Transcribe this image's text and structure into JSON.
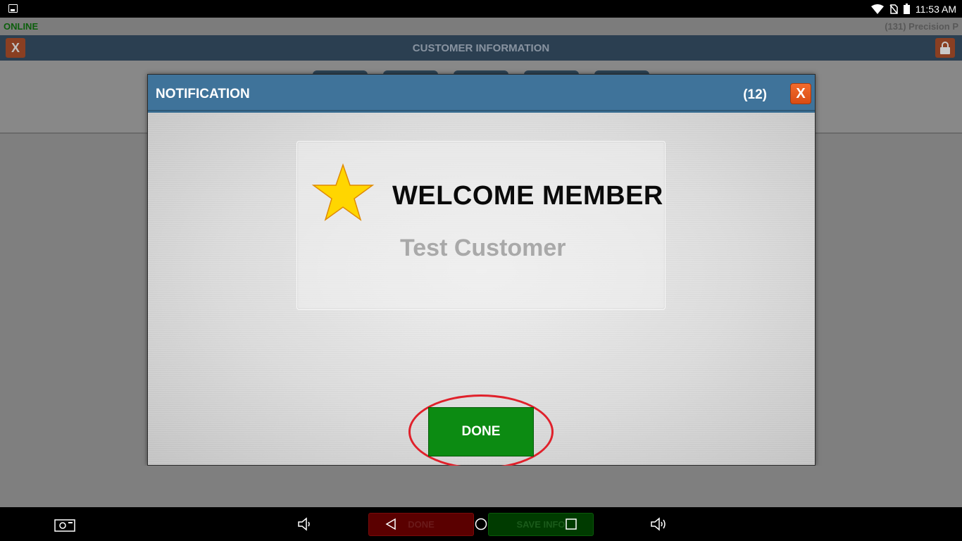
{
  "status_bar": {
    "time": "11:53 AM",
    "icons": [
      "image-icon",
      "wifi-icon",
      "no-sim-icon",
      "battery-icon"
    ]
  },
  "info_bar": {
    "status": "ONLINE",
    "store": "(131) Precision P"
  },
  "header": {
    "title": "CUSTOMER INFORMATION",
    "close_label": "X",
    "lock_icon": "lock-icon"
  },
  "dialog": {
    "title": "NOTIFICATION",
    "count": "(12)",
    "close_label": "X",
    "headline": "WELCOME MEMBER",
    "customer_name": "Test Customer",
    "done_label": "DONE",
    "star_icon": "star-icon"
  },
  "bottom_bar": {
    "done_label": "DONE",
    "save_label": "SAVE INFO"
  },
  "nav_icons": [
    "screenshot-icon",
    "volume-down-icon",
    "back-icon",
    "home-icon",
    "recents-icon",
    "volume-up-icon"
  ],
  "colors": {
    "header_blue": "#3f739a",
    "done_green": "#0c8b12",
    "close_orange": "#e85a1e",
    "highlight_red": "#e0212b",
    "star_yellow": "#ffd600"
  }
}
